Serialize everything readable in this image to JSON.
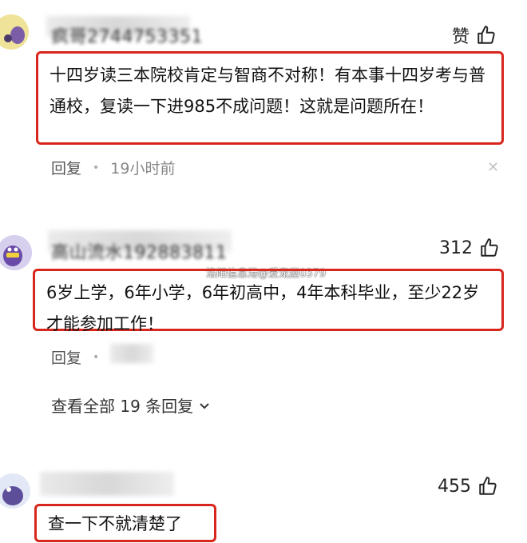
{
  "comments": [
    {
      "username": "疯哥2744753351",
      "like_label": "赞",
      "text": "十四岁读三本院校肯定与智商不对称！有本事十四岁考与普通校，复读一下进985不成问题！这就是问题所在！",
      "reply_label": "回复",
      "time": "19小时前"
    },
    {
      "username": "高山流水192883811",
      "like_count": "312",
      "text": "6岁上学，6年小学，6年初高中，4年本科毕业，至少22岁才能参加工作！",
      "reply_label": "回复",
      "view_replies": "查看全部 19 条回复"
    },
    {
      "like_count": "455",
      "text": "查一下不就清楚了"
    }
  ],
  "watermark": "洛阳信息港@爱宠屋0379",
  "icons": {
    "like": "thumbs-up-icon",
    "close": "close-icon",
    "chevron": "chevron-down-icon"
  },
  "colors": {
    "highlight_border": "#d9261c"
  }
}
